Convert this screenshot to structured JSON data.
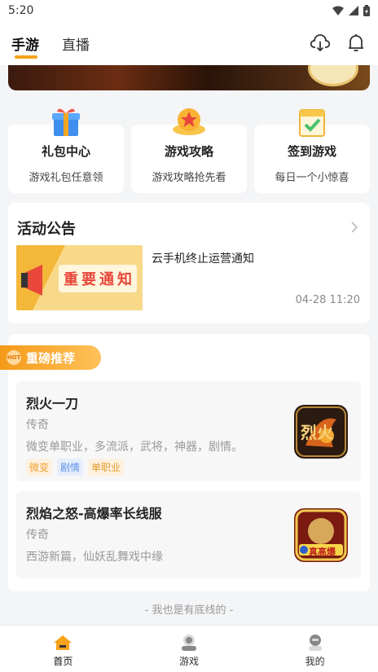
{
  "status_bar": {
    "time": "5:20",
    "icons": [
      "wifi-icon",
      "signal-icon",
      "battery-icon"
    ]
  },
  "top_nav": {
    "tabs": [
      {
        "label": "手游",
        "active": true
      },
      {
        "label": "直播",
        "active": false
      }
    ],
    "actions": [
      "download-icon",
      "bell-icon"
    ]
  },
  "quick_entries": [
    {
      "title": "礼包中心",
      "subtitle": "游戏礼包任意领",
      "icon": "gift-icon"
    },
    {
      "title": "游戏攻略",
      "subtitle": "游戏攻略抢先看",
      "icon": "star-badge-icon"
    },
    {
      "title": "签到游戏",
      "subtitle": "每日一个小惊喜",
      "icon": "calendar-check-icon"
    }
  ],
  "notice": {
    "title": "活动公告",
    "item_title": "云手机终止运营通知",
    "time": "04-28 11:20",
    "thumb_text": "重要通知"
  },
  "recommend": {
    "badge_label": "重磅推荐",
    "hot_text": "HOT",
    "games": [
      {
        "name": "烈火一刀",
        "genre": "传奇",
        "desc": "微变单职业，多流派，武将，神器，剧情。",
        "tags": [
          "微变",
          "剧情",
          "单职业"
        ],
        "thumb_text": "烈火"
      },
      {
        "name": "烈焰之怒-高爆率长线服",
        "genre": "传奇",
        "desc": "西游新篇，仙妖乱舞戏中缘",
        "tags": [],
        "thumb_text": "真高爆"
      }
    ]
  },
  "footer": {
    "text": "- 我也是有底线的 -"
  },
  "bottom_nav": {
    "items": [
      {
        "label": "首页",
        "icon": "home-icon",
        "active": true
      },
      {
        "label": "游戏",
        "icon": "game-user-icon",
        "active": false
      },
      {
        "label": "我的",
        "icon": "profile-icon",
        "active": false
      }
    ]
  },
  "colors": {
    "accent": "#f7a21b",
    "background": "#f4f5f7"
  }
}
